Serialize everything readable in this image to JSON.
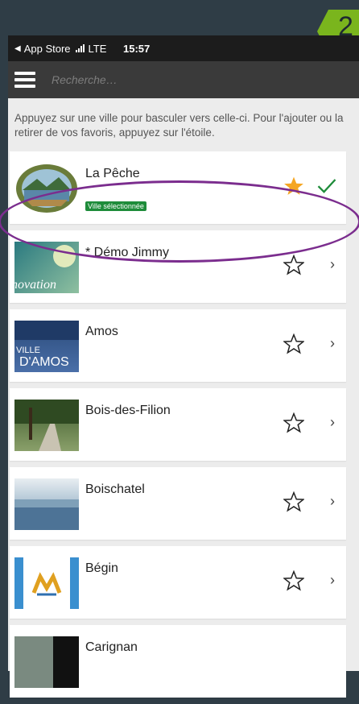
{
  "step_marker": "2",
  "status": {
    "carrier": "App Store",
    "network": "LTE",
    "time": "15:57"
  },
  "search": {
    "placeholder": "Recherche…"
  },
  "help_text": "Appuyez sur une ville pour basculer vers celle-ci. Pour l'ajouter ou la retirer de vos favoris, appuyez sur l'étoile.",
  "badge_selected": "Ville sélectionnée",
  "cities": [
    {
      "name": "La Pêche",
      "favorite": true,
      "selected": true
    },
    {
      "name": "* Démo Jimmy",
      "favorite": false,
      "selected": false,
      "thumb_text": "novation"
    },
    {
      "name": "Amos",
      "favorite": false,
      "selected": false,
      "thumb_text": "VILLE D'AMOS"
    },
    {
      "name": "Bois-des-Filion",
      "favorite": false,
      "selected": false
    },
    {
      "name": "Boischatel",
      "favorite": false,
      "selected": false
    },
    {
      "name": "Bégin",
      "favorite": false,
      "selected": false
    },
    {
      "name": "Carignan",
      "favorite": false,
      "selected": false
    }
  ],
  "colors": {
    "accent_green": "#1e8c3a",
    "star_gold": "#f5a623",
    "highlight": "#7b2d8e",
    "marker": "#7ab51d"
  }
}
